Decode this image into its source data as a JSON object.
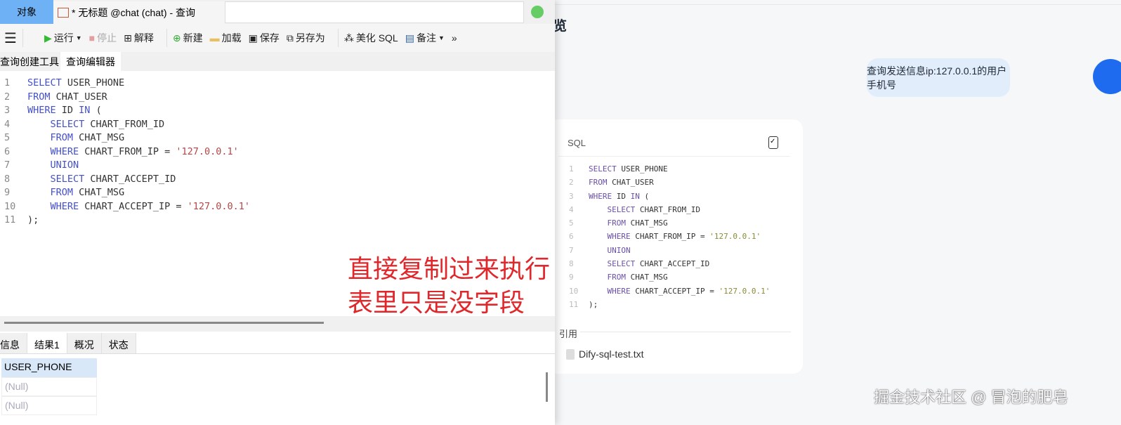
{
  "left": {
    "tabs": {
      "objects": "对象",
      "query": "* 无标题 @chat (chat) - 查询"
    },
    "toolbar": {
      "run": "运行",
      "stop": "停止",
      "explain": "解释",
      "new": "新建",
      "load": "加载",
      "save": "保存",
      "save_as": "另存为",
      "beautify": "美化 SQL",
      "comment": "备注",
      "more": "»"
    },
    "subtabs": [
      "查询创建工具",
      "查询编辑器"
    ],
    "code": [
      [
        [
          "kw",
          "SELECT "
        ],
        [
          "tx",
          "USER_PHONE"
        ]
      ],
      [
        [
          "kw",
          "FROM "
        ],
        [
          "tx",
          "CHAT_USER"
        ]
      ],
      [
        [
          "kw",
          "WHERE "
        ],
        [
          "tx",
          "ID "
        ],
        [
          "kw",
          "IN "
        ],
        [
          "tx",
          "("
        ]
      ],
      [
        [
          "tx",
          "    "
        ],
        [
          "kw",
          "SELECT "
        ],
        [
          "tx",
          "CHART_FROM_ID"
        ]
      ],
      [
        [
          "tx",
          "    "
        ],
        [
          "kw",
          "FROM "
        ],
        [
          "tx",
          "CHAT_MSG"
        ]
      ],
      [
        [
          "tx",
          "    "
        ],
        [
          "kw",
          "WHERE "
        ],
        [
          "tx",
          "CHART_FROM_IP = "
        ],
        [
          "st",
          "'127.0.0.1'"
        ]
      ],
      [
        [
          "tx",
          "    "
        ],
        [
          "kw",
          "UNION"
        ]
      ],
      [
        [
          "tx",
          "    "
        ],
        [
          "kw",
          "SELECT "
        ],
        [
          "tx",
          "CHART_ACCEPT_ID"
        ]
      ],
      [
        [
          "tx",
          "    "
        ],
        [
          "kw",
          "FROM "
        ],
        [
          "tx",
          "CHAT_MSG"
        ]
      ],
      [
        [
          "tx",
          "    "
        ],
        [
          "kw",
          "WHERE "
        ],
        [
          "tx",
          "CHART_ACCEPT_IP = "
        ],
        [
          "st",
          "'127.0.0.1'"
        ]
      ],
      [
        [
          "tx",
          ");"
        ]
      ]
    ],
    "annotation": [
      "直接复制过来执行",
      "表里只是没字段"
    ],
    "result_tabs": [
      "信息",
      "结果1",
      "概况",
      "状态"
    ],
    "grid": {
      "header": "USER_PHONE",
      "rows": [
        "(Null)",
        "(Null)"
      ]
    }
  },
  "right": {
    "title": "览",
    "user_message": "查询发送信息ip:127.0.0.1的用户手机号",
    "sql_label": "SQL",
    "citation_label": "引用",
    "file": "Dify-sql-test.txt",
    "watermark": "掘金技术社区 @ 冒泡的肥皂"
  },
  "colors": {
    "accent": "#1f6bf0",
    "annotation": "#e0272b"
  }
}
